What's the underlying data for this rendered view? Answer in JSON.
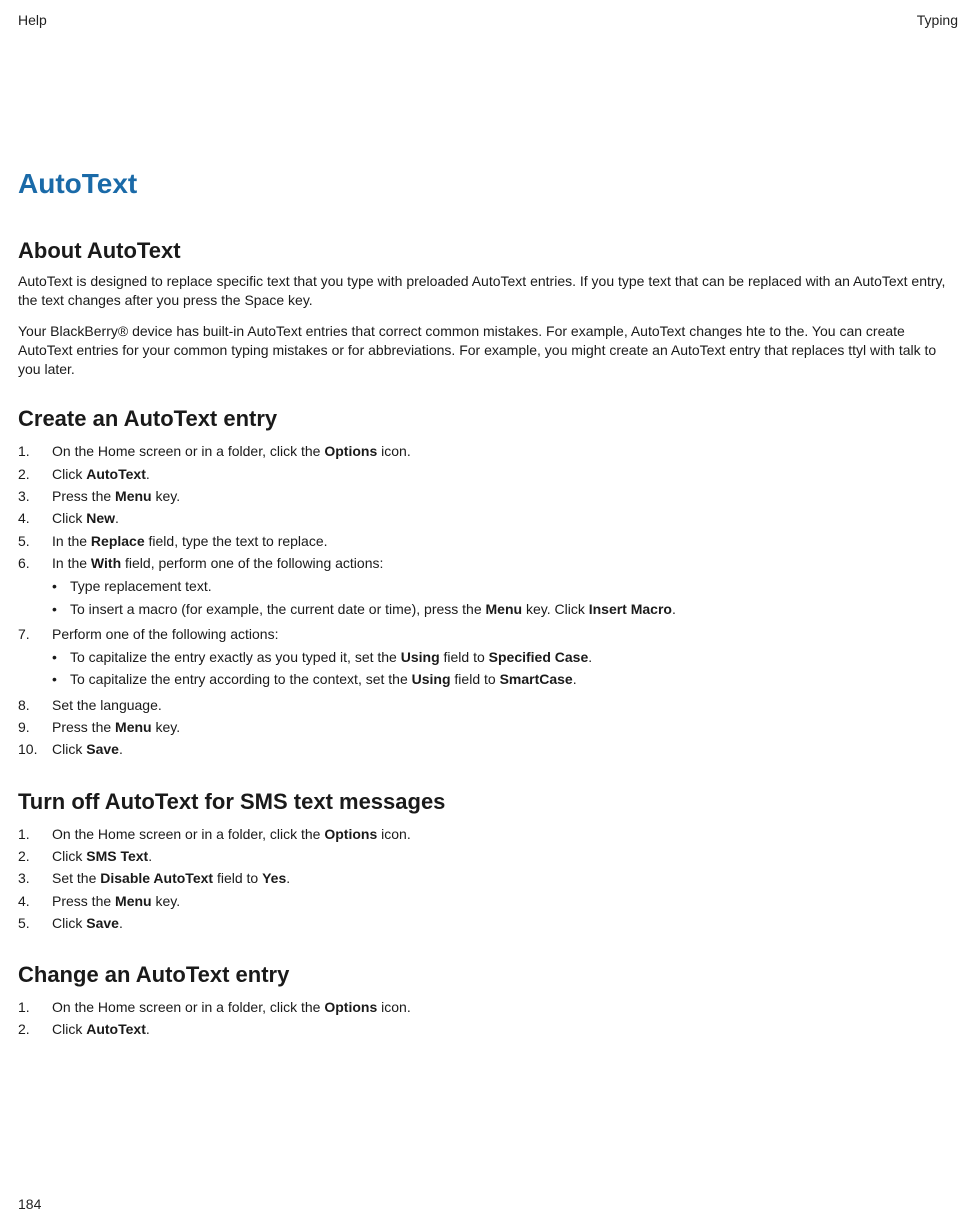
{
  "header": {
    "left": "Help",
    "right": "Typing"
  },
  "title": "AutoText",
  "about": {
    "heading": "About AutoText",
    "p1": "AutoText is designed to replace specific text that you type with preloaded AutoText entries. If you type text that can be replaced with an AutoText entry, the text changes after you press the Space key.",
    "p2": "Your BlackBerry® device has built-in AutoText entries that correct common mistakes. For example, AutoText changes hte to the. You can create AutoText entries for your common typing mistakes or for abbreviations. For example, you might create an AutoText entry that replaces ttyl with talk to you later."
  },
  "create": {
    "heading": "Create an AutoText entry",
    "s1_a": "On the Home screen or in a folder, click the ",
    "s1_b": "Options",
    "s1_c": " icon.",
    "s2_a": "Click ",
    "s2_b": "AutoText",
    "s2_c": ".",
    "s3_a": "Press the ",
    "s3_b": "Menu",
    "s3_c": " key.",
    "s4_a": "Click ",
    "s4_b": "New",
    "s4_c": ".",
    "s5_a": "In the ",
    "s5_b": "Replace",
    "s5_c": " field, type the text to replace.",
    "s6_a": "In the ",
    "s6_b": "With",
    "s6_c": " field, perform one of the following actions:",
    "s6_sub1": "Type replacement text.",
    "s6_sub2_a": "To insert a macro (for example, the current date or time), press the ",
    "s6_sub2_b": "Menu",
    "s6_sub2_c": " key. Click ",
    "s6_sub2_d": "Insert Macro",
    "s6_sub2_e": ".",
    "s7": "Perform one of the following actions:",
    "s7_sub1_a": "To capitalize the entry exactly as you typed it, set the ",
    "s7_sub1_b": "Using",
    "s7_sub1_c": " field to ",
    "s7_sub1_d": "Specified Case",
    "s7_sub1_e": ".",
    "s7_sub2_a": "To capitalize the entry according to the context, set the ",
    "s7_sub2_b": "Using",
    "s7_sub2_c": " field to ",
    "s7_sub2_d": "SmartCase",
    "s7_sub2_e": ".",
    "s8": "Set the language.",
    "s9_a": "Press the ",
    "s9_b": "Menu",
    "s9_c": " key.",
    "s10_a": "Click ",
    "s10_b": "Save",
    "s10_c": "."
  },
  "turnoff": {
    "heading": "Turn off AutoText for SMS text messages",
    "s1_a": "On the Home screen or in a folder, click the ",
    "s1_b": "Options",
    "s1_c": " icon.",
    "s2_a": "Click ",
    "s2_b": "SMS Text",
    "s2_c": ".",
    "s3_a": "Set the ",
    "s3_b": "Disable AutoText",
    "s3_c": " field to ",
    "s3_d": "Yes",
    "s3_e": ".",
    "s4_a": "Press the ",
    "s4_b": "Menu",
    "s4_c": " key.",
    "s5_a": "Click ",
    "s5_b": "Save",
    "s5_c": "."
  },
  "change": {
    "heading": "Change an AutoText entry",
    "s1_a": "On the Home screen or in a folder, click the ",
    "s1_b": "Options",
    "s1_c": " icon.",
    "s2_a": "Click ",
    "s2_b": "AutoText",
    "s2_c": "."
  },
  "footer": {
    "page": "184"
  }
}
